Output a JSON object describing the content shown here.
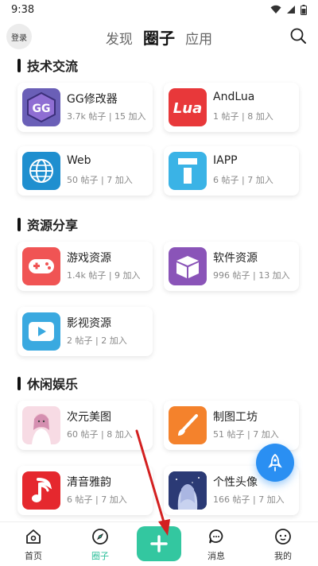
{
  "status": {
    "time": "9:38"
  },
  "header": {
    "login_label": "登录",
    "tabs": [
      {
        "label": "发现",
        "active": false
      },
      {
        "label": "圈子",
        "active": true
      },
      {
        "label": "应用",
        "active": false
      }
    ]
  },
  "sections": [
    {
      "title": "技术交流",
      "cards": [
        {
          "name": "GG修改器",
          "meta": "3.7k 帖子 | 15 加入",
          "icon": "gg-icon",
          "color": "#6a5fb7"
        },
        {
          "name": "AndLua",
          "meta": "1 帖子 | 8 加入",
          "icon": "lua-icon",
          "color": "#e8383a"
        },
        {
          "name": "Web",
          "meta": "50 帖子 | 7 加入",
          "icon": "globe-icon",
          "color": "#1f8fcf"
        },
        {
          "name": "IAPP",
          "meta": "6 帖子 | 7 加入",
          "icon": "iapp-icon",
          "color": "#3ab3e6"
        }
      ]
    },
    {
      "title": "资源分享",
      "cards": [
        {
          "name": "游戏资源",
          "meta": "1.4k 帖子 | 9 加入",
          "icon": "gamepad-icon",
          "color": "#f05454"
        },
        {
          "name": "软件资源",
          "meta": "996 帖子 | 13 加入",
          "icon": "box-icon",
          "color": "#8a54b8"
        },
        {
          "name": "影视资源",
          "meta": "2 帖子 | 2 加入",
          "icon": "play-icon",
          "color": "#3aa9e0"
        }
      ]
    },
    {
      "title": "休闲娱乐",
      "cards": [
        {
          "name": "次元美图",
          "meta": "60 帖子 | 8 加入",
          "icon": "anime-image-icon",
          "color": "#f3b6c8"
        },
        {
          "name": "制图工坊",
          "meta": "51 帖子 | 7 加入",
          "icon": "brush-icon",
          "color": "#f4822c"
        },
        {
          "name": "清音雅韵",
          "meta": "6 帖子 | 7 加入",
          "icon": "music-icon",
          "color": "#e5282e"
        },
        {
          "name": "个性头像",
          "meta": "166 帖子 | 7 加入",
          "icon": "avatar-image-icon",
          "color": "#7e8fc2"
        }
      ]
    }
  ],
  "bottom_nav": [
    {
      "label": "首页",
      "icon": "home-icon",
      "active": false
    },
    {
      "label": "圈子",
      "icon": "compass-icon",
      "active": true
    },
    {
      "label": "消息",
      "icon": "chat-icon",
      "active": false
    },
    {
      "label": "我的",
      "icon": "profile-icon",
      "active": false
    }
  ],
  "colors": {
    "accent": "#33c7a0",
    "rocket": "#2a8ff2",
    "arrow": "#d32020"
  }
}
